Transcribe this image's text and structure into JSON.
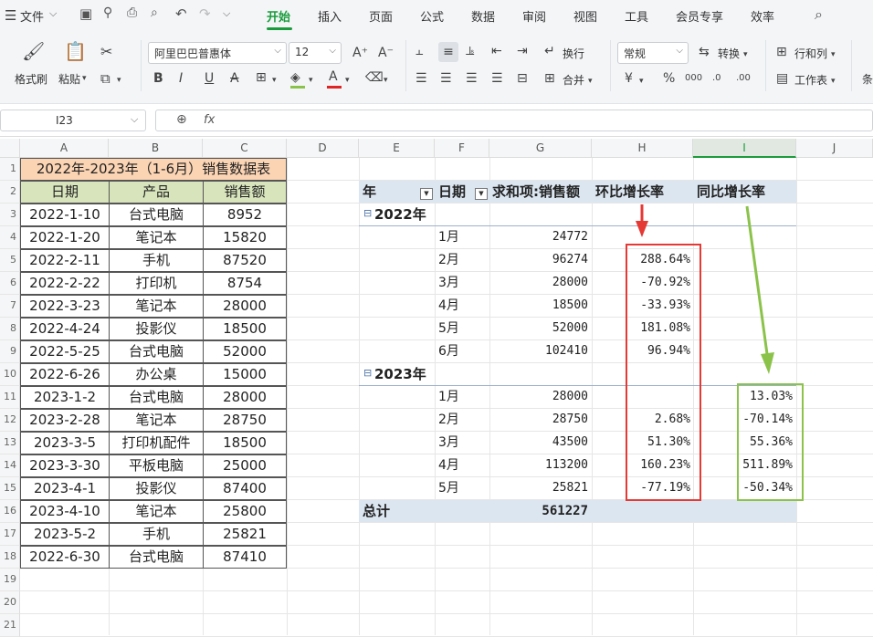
{
  "menubar": {
    "menu_icon": "hamburger-icon",
    "file_label": "文件",
    "tabs": [
      "开始",
      "插入",
      "页面",
      "公式",
      "数据",
      "审阅",
      "视图",
      "工具",
      "会员专享",
      "效率"
    ],
    "active_tab": "开始",
    "search_icon": "search-icon"
  },
  "ribbon": {
    "format_painter": "格式刷",
    "paste": "粘贴",
    "font_name": "阿里巴巴普惠体",
    "font_size": "12",
    "wrap": "换行",
    "merge": "合并",
    "number_format": "常规",
    "convert": "转换",
    "rows_cols": "行和列",
    "worksheet": "工作表",
    "cond_partial": "条",
    "currency": "¥",
    "percent": "%",
    "thousands": "000",
    "accent_color": "#1a9c3c",
    "font_color": "#e02424"
  },
  "formula_bar": {
    "name_box": "I23",
    "fx": "fx",
    "formula": ""
  },
  "sheet": {
    "columns": [
      "A",
      "B",
      "C",
      "D",
      "E",
      "F",
      "G",
      "H",
      "I",
      "J"
    ],
    "selected_column": "I",
    "row_numbers": [
      "1",
      "2",
      "3",
      "4",
      "5",
      "6",
      "7",
      "8",
      "9",
      "10",
      "11",
      "12",
      "13",
      "14",
      "15",
      "16",
      "17",
      "18",
      "19",
      "20",
      "21"
    ],
    "source_table": {
      "title": "2022年-2023年（1-6月）销售数据表",
      "headers": [
        "日期",
        "产品",
        "销售额"
      ],
      "rows": [
        [
          "2022-1-10",
          "台式电脑",
          "8952"
        ],
        [
          "2022-1-20",
          "笔记本",
          "15820"
        ],
        [
          "2022-2-11",
          "手机",
          "87520"
        ],
        [
          "2022-2-22",
          "打印机",
          "8754"
        ],
        [
          "2022-3-23",
          "笔记本",
          "28000"
        ],
        [
          "2022-4-24",
          "投影仪",
          "18500"
        ],
        [
          "2022-5-25",
          "台式电脑",
          "52000"
        ],
        [
          "2022-6-26",
          "办公桌",
          "15000"
        ],
        [
          "2023-1-2",
          "台式电脑",
          "28000"
        ],
        [
          "2023-2-28",
          "笔记本",
          "28750"
        ],
        [
          "2023-3-5",
          "打印机配件",
          "18500"
        ],
        [
          "2023-3-30",
          "平板电脑",
          "25000"
        ],
        [
          "2023-4-1",
          "投影仪",
          "87400"
        ],
        [
          "2023-4-10",
          "笔记本",
          "25800"
        ],
        [
          "2023-5-2",
          "手机",
          "25821"
        ],
        [
          "2022-6-30",
          "台式电脑",
          "87410"
        ]
      ],
      "title_bg": "#fbd4b4",
      "header_bg": "#d8e4bc"
    },
    "pivot": {
      "headers": [
        "年",
        "日期",
        "求和项:销售额",
        "环比增长率",
        "同比增长率"
      ],
      "groups": [
        {
          "year": "2022年",
          "rows": [
            {
              "month": "1月",
              "sum": "24772",
              "mom": "",
              "yoy": ""
            },
            {
              "month": "2月",
              "sum": "96274",
              "mom": "288.64%",
              "yoy": ""
            },
            {
              "month": "3月",
              "sum": "28000",
              "mom": "-70.92%",
              "yoy": ""
            },
            {
              "month": "4月",
              "sum": "18500",
              "mom": "-33.93%",
              "yoy": ""
            },
            {
              "month": "5月",
              "sum": "52000",
              "mom": "181.08%",
              "yoy": ""
            },
            {
              "month": "6月",
              "sum": "102410",
              "mom": "96.94%",
              "yoy": ""
            }
          ]
        },
        {
          "year": "2023年",
          "rows": [
            {
              "month": "1月",
              "sum": "28000",
              "mom": "",
              "yoy": "13.03%"
            },
            {
              "month": "2月",
              "sum": "28750",
              "mom": "2.68%",
              "yoy": "-70.14%"
            },
            {
              "month": "3月",
              "sum": "43500",
              "mom": "51.30%",
              "yoy": "55.36%"
            },
            {
              "month": "4月",
              "sum": "113200",
              "mom": "160.23%",
              "yoy": "511.89%"
            },
            {
              "month": "5月",
              "sum": "25821",
              "mom": "-77.19%",
              "yoy": "-50.34%"
            }
          ]
        }
      ],
      "total_label": "总计",
      "total_value": "561227",
      "header_bg": "#dce6f1",
      "mom_highlight_color": "#e53935",
      "yoy_highlight_color": "#8bc34a"
    }
  }
}
